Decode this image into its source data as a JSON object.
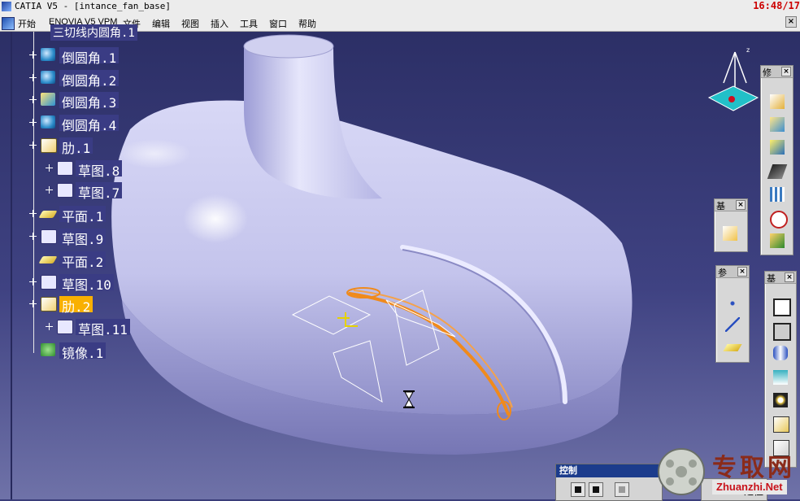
{
  "window": {
    "title": "CATIA V5 - [intance_fan_base]",
    "clock": "16:48/17"
  },
  "menubar": {
    "items": [
      "开始",
      "ENOVIA V5 VPM",
      "文件",
      "编辑",
      "视图",
      "插入",
      "工具",
      "窗口",
      "帮助"
    ]
  },
  "tree": {
    "partial_top": "三切线内圆角.1",
    "nodes": [
      {
        "label": "倒圆角.1",
        "icon": "fillet-icon"
      },
      {
        "label": "倒圆角.2",
        "icon": "fillet-icon"
      },
      {
        "label": "倒圆角.3",
        "icon": "fillet-icon"
      },
      {
        "label": "倒圆角.4",
        "icon": "fillet-icon"
      },
      {
        "label": "肋.1",
        "icon": "rib-icon"
      },
      {
        "label": "草图.8",
        "icon": "sketch-icon"
      },
      {
        "label": "草图.7",
        "icon": "sketch-icon"
      },
      {
        "label": "平面.1",
        "icon": "plane-icon"
      },
      {
        "label": "草图.9",
        "icon": "sketch-icon"
      },
      {
        "label": "平面.2",
        "icon": "plane-icon"
      },
      {
        "label": "草图.10",
        "icon": "sketch-icon"
      },
      {
        "label": "肋.2",
        "icon": "rib-icon",
        "selected": true
      },
      {
        "label": "草图.11",
        "icon": "sketch-icon"
      },
      {
        "label": "镜像.1",
        "icon": "mirror-icon"
      }
    ]
  },
  "toolbars": {
    "dress_up": {
      "title": "修"
    },
    "reference": {
      "title": "基"
    },
    "params": {
      "title": "参"
    },
    "sketch_based": {
      "title": "基"
    }
  },
  "control": {
    "title": "控制"
  },
  "locate": {
    "label": "定位"
  },
  "watermark": {
    "cn": "专取网",
    "url": "Zhuanzhi.Net"
  },
  "colors": {
    "background_top": "#2c2f66",
    "background_bottom": "#6f72a8",
    "part_surface": "#c9c9f0",
    "highlight": "#f08a1c",
    "selection": "#f9b000"
  }
}
